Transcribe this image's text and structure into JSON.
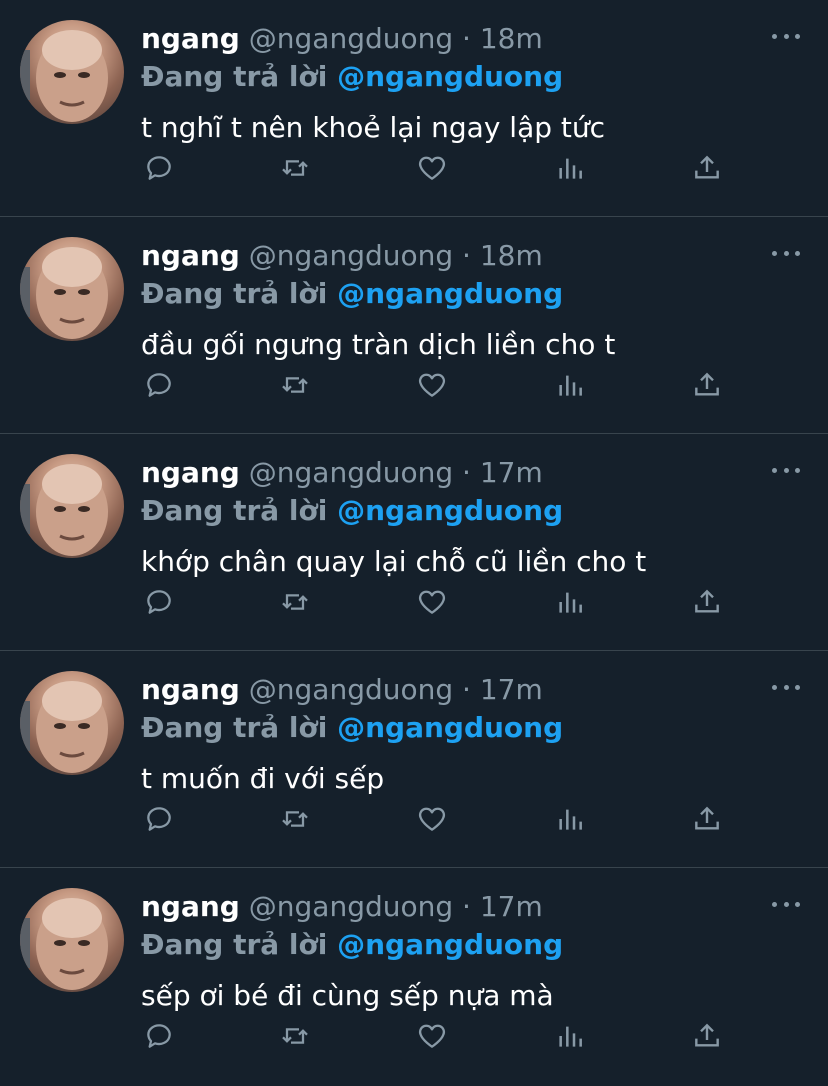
{
  "tweets": [
    {
      "name": "ngang",
      "handle": "@ngangduong",
      "dot": "·",
      "time": "18m",
      "reply_label": "Đang trả lời",
      "reply_to": "@ngangduong",
      "text": "t nghĩ t nên khoẻ lại ngay lập tức"
    },
    {
      "name": "ngang",
      "handle": "@ngangduong",
      "dot": "·",
      "time": "18m",
      "reply_label": "Đang trả lời",
      "reply_to": "@ngangduong",
      "text": "đầu gối ngưng tràn dịch liền cho t"
    },
    {
      "name": "ngang",
      "handle": "@ngangduong",
      "dot": "·",
      "time": "17m",
      "reply_label": "Đang trả lời",
      "reply_to": "@ngangduong",
      "text": "khớp chân quay lại chỗ cũ liền cho t"
    },
    {
      "name": "ngang",
      "handle": "@ngangduong",
      "dot": "·",
      "time": "17m",
      "reply_label": "Đang trả lời",
      "reply_to": "@ngangduong",
      "text": "t muốn đi với sếp"
    },
    {
      "name": "ngang",
      "handle": "@ngangduong",
      "dot": "·",
      "time": "17m",
      "reply_label": "Đang trả lời",
      "reply_to": "@ngangduong",
      "text": "sếp ơi bé đi cùng sếp nựa mà"
    }
  ],
  "icons": {
    "reply": "reply-icon",
    "retweet": "retweet-icon",
    "like": "heart-icon",
    "stats": "stats-icon",
    "share": "share-icon",
    "more": "more-icon"
  },
  "colors": {
    "background": "#15202b",
    "muted": "#8899a6",
    "accent": "#1da1f2",
    "divider": "#38444d"
  }
}
